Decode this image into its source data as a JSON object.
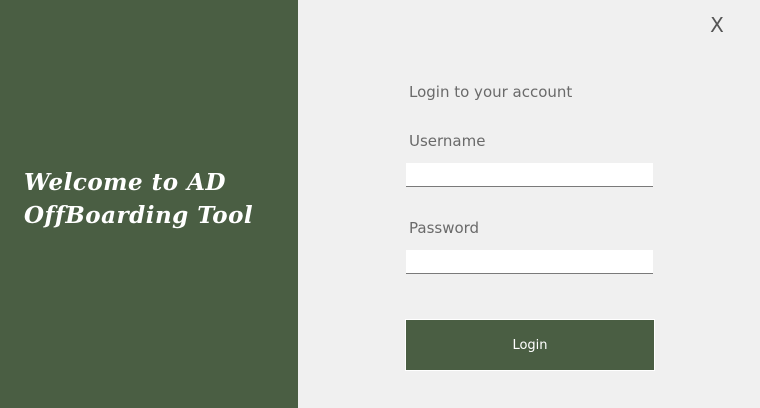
{
  "colors": {
    "brand_green": "#4a5e43",
    "background": "#f0f0f0",
    "text_muted": "#6a6a6a"
  },
  "sidebar": {
    "welcome_line1": "Welcome to AD",
    "welcome_line2": "OffBoarding Tool"
  },
  "window": {
    "close_label": "X"
  },
  "form": {
    "heading": "Login to your account",
    "username_label": "Username",
    "username_value": "",
    "password_label": "Password",
    "password_value": "",
    "login_button": "Login"
  }
}
